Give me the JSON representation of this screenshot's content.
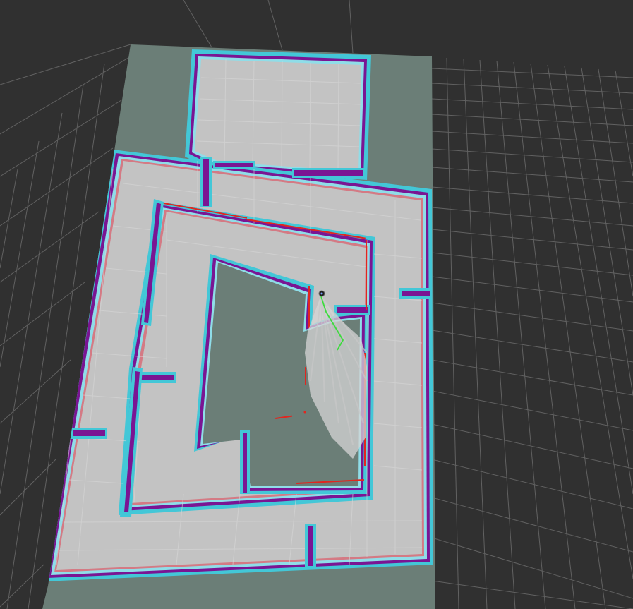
{
  "app": {
    "view_type": "rviz-3d-view",
    "displays": [
      "grid",
      "map",
      "costmap",
      "laser-scan",
      "global-plan",
      "robot-pose"
    ]
  },
  "colors": {
    "background": "#303030",
    "grid_line": "#a0a0a0",
    "unknown_space": "#6c8078",
    "free_space": "#c3c3c3",
    "free_grid": "#d6d6d6",
    "inflation_cyan": "#43c7d7",
    "inflation_light": "#8fdde8",
    "lethal_purple": "#7a1593",
    "inscribed_pink": "#d47a84",
    "laser_red": "#e1261f",
    "plan_green": "#3cdc3c",
    "robot": "#202020"
  }
}
